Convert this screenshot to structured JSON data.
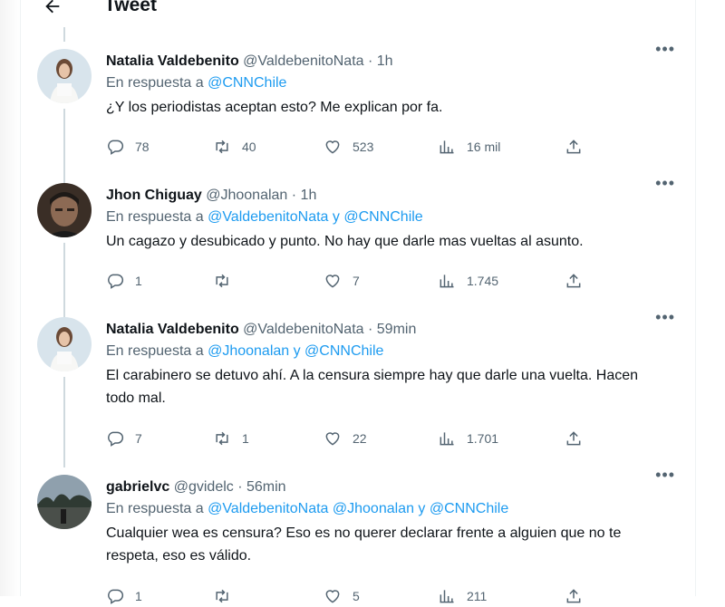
{
  "header": {
    "title": "Tweet",
    "back_icon": "arrow-left-icon"
  },
  "tweets": [
    {
      "name": "Natalia Valdebenito",
      "handle": "@ValdebenitoNata",
      "time": "· 1h",
      "reply_prefix": "En respuesta a",
      "reply_to": "@CNNChile",
      "text": "¿Y los periodistas aceptan esto? Me explican por fa.",
      "replies": "78",
      "retweets": "40",
      "likes": "523",
      "views": "16 mil",
      "avatar": "woman-white-shirt"
    },
    {
      "name": "Jhon Chiguay",
      "handle": "@Jhoonalan",
      "time": "· 1h",
      "reply_prefix": "En respuesta a",
      "reply_to": "@ValdebenitoNata y @CNNChile",
      "text": "Un cagazo y desubicado y punto. No hay que darle mas vueltas al asunto.",
      "replies": "1",
      "retweets": "",
      "likes": "7",
      "views": "1.745",
      "avatar": "man-dark-photo"
    },
    {
      "name": "Natalia Valdebenito",
      "handle": "@ValdebenitoNata",
      "time": "· 59min",
      "reply_prefix": "En respuesta a",
      "reply_to": "@Jhoonalan y @CNNChile",
      "text": "El carabinero se detuvo ahí. A la censura siempre hay que darle una vuelta. Hacen todo mal.",
      "replies": "7",
      "retweets": "1",
      "likes": "22",
      "views": "1.701",
      "avatar": "woman-white-shirt"
    },
    {
      "name": "gabrielvc",
      "handle": "@gvidelc",
      "time": "· 56min",
      "reply_prefix": "En respuesta a",
      "reply_to": "@ValdebenitoNata @Jhoonalan y @CNNChile",
      "text": "Cualquier wea es censura? Eso es no querer declarar frente a alguien que no te respeta, eso es válido.",
      "replies": "1",
      "retweets": "",
      "likes": "5",
      "views": "211",
      "avatar": "landscape-photo"
    }
  ],
  "colors": {
    "accent": "#1d9bf0",
    "muted": "#536471",
    "text": "#0f1419",
    "thread": "#cfd9de"
  }
}
